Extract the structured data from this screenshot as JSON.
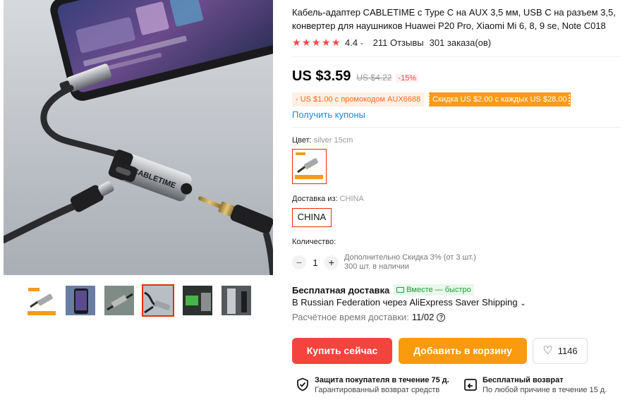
{
  "product": {
    "title": "Кабель-адаптер CABLETIME с Type C на AUX 3,5 мм, USB C на разъем 3,5, конвертер для наушников Huawei P20 Pro, Xiaomi Mi 6, 8, 9 se, Note C018",
    "rating": "4.4",
    "reviews": "211 Отзывы",
    "orders": "301 заказа(ов)"
  },
  "gallery": {
    "main_image": "USB-C to 3.5mm audio adapter cable product photo",
    "thumbnails": 6,
    "active_thumbnail": 4,
    "brand_print": "CABLETIME"
  },
  "pricing": {
    "price": "US $3.59",
    "old_price": "US $4.22",
    "discount": "-15%",
    "coupon_promo": "- US $1.00 с промокодом AUX6688",
    "coupon_store": "Скидка US $2.00 с каждых US $28.00",
    "get_coupons": "Получить купоны"
  },
  "options": {
    "color_label": "Цвет:",
    "color_value": "silver 15cm",
    "ship_from_label": "Доставка из:",
    "ship_from_value": "CHINA",
    "ship_from_button": "CHINA"
  },
  "quantity": {
    "label": "Количество:",
    "value": "1",
    "extra_discount": "Дополнительно Скидка 3% (от 3 шт.)",
    "available": "300 шт. в наличии"
  },
  "shipping": {
    "free_label": "Бесплатная доставка",
    "fast_badge": "Вместе — быстро",
    "route": "В Russian Federation через AliExpress Saver Shipping",
    "est_label": "Расчётное время доставки:",
    "est_date": "11/02"
  },
  "actions": {
    "buy_now": "Купить сейчас",
    "add_to_cart": "Добавить в корзину",
    "wishlist_count": "1146"
  },
  "guarantees": [
    {
      "title": "Защита покупателя в течение 75 д.",
      "subtitle": "Гарантированный возврат средств",
      "icon": "shield-check-icon"
    },
    {
      "title": "Бесплатный возврат",
      "subtitle": "По любой причине в течение 15 д.",
      "icon": "return-icon"
    }
  ],
  "colors": {
    "accent_red": "#f3453d",
    "accent_orange": "#fa9a0d",
    "link_blue": "#1c8cd6",
    "green": "#1b9f3c"
  }
}
